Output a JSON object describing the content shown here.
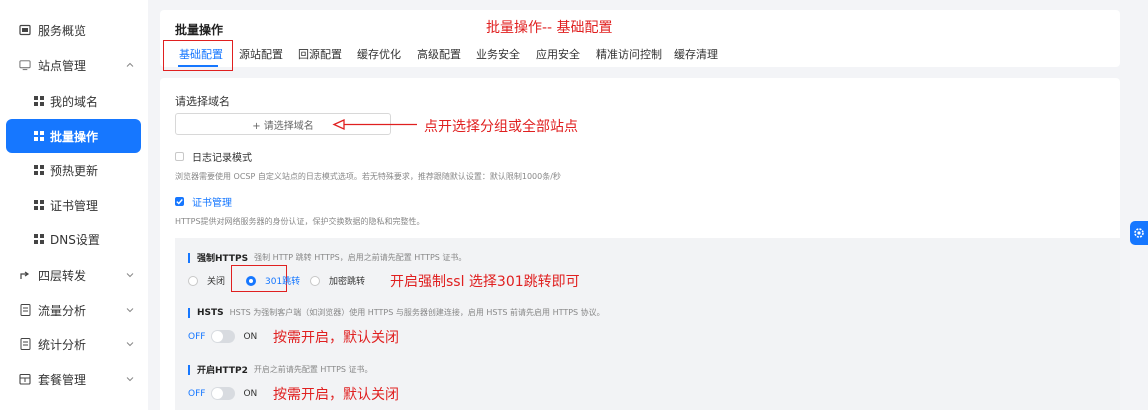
{
  "sidebar": {
    "items": [
      {
        "label": "服务概览",
        "icon": "dashboard-icon"
      },
      {
        "label": "站点管理",
        "icon": "site-icon"
      },
      {
        "label": "我的域名",
        "icon": "grid-icon"
      },
      {
        "label": "批量操作",
        "icon": "grid-icon"
      },
      {
        "label": "预热更新",
        "icon": "grid-icon"
      },
      {
        "label": "证书管理",
        "icon": "grid-icon"
      },
      {
        "label": "DNS设置",
        "icon": "grid-icon"
      },
      {
        "label": "四层转发",
        "icon": "forward-icon"
      },
      {
        "label": "流量分析",
        "icon": "doc-icon"
      },
      {
        "label": "统计分析",
        "icon": "doc-icon"
      },
      {
        "label": "套餐管理",
        "icon": "package-icon"
      }
    ]
  },
  "header": {
    "title": "批量操作",
    "tabs": [
      "基础配置",
      "源站配置",
      "回源配置",
      "缓存优化",
      "高级配置",
      "业务安全",
      "应用安全",
      "精准访问控制",
      "缓存清理"
    ],
    "active_tab": 0
  },
  "annotations": {
    "title_note": "批量操作-- 基础配置",
    "domain_note": "点开选择分组或全部站点",
    "https_note": "开启强制ssl 选择301跳转即可",
    "hsts_note": "按需开启，默认关闭",
    "http2_note": "按需开启，默认关闭"
  },
  "form": {
    "domain_label": "请选择域名",
    "domain_placeholder": "+ 请选择域名",
    "log_mode_label": "日志记录模式",
    "log_mode_desc": "浏览器需要使用 OCSP 自定义站点的日志模式选项。若无特殊要求，推荐跟随默认设置：默认限制1000条/秒",
    "cert_label": "证书管理",
    "cert_desc": "HTTPS提供对网络服务器的身份认证，保护交换数据的隐私和完整性。",
    "force_https": {
      "title": "强制HTTPS",
      "desc": "强制 HTTP 跳转 HTTPS，启用之前请先配置 HTTPS 证书。",
      "options": [
        "关闭",
        "301跳转",
        "加密跳转"
      ],
      "selected": 1
    },
    "hsts": {
      "title": "HSTS",
      "desc": "HSTS 为强制客户端（如浏览器）使用 HTTPS 与服务器创建连接，启用 HSTS 前请先启用 HTTPS 协议。",
      "off": "OFF",
      "on": "ON"
    },
    "http2": {
      "title": "开启HTTP2",
      "desc": "开启之前请先配置 HTTPS 证书。",
      "off": "OFF",
      "on": "ON"
    }
  },
  "colors": {
    "accent": "#1677ff",
    "annotation": "#e02020"
  }
}
